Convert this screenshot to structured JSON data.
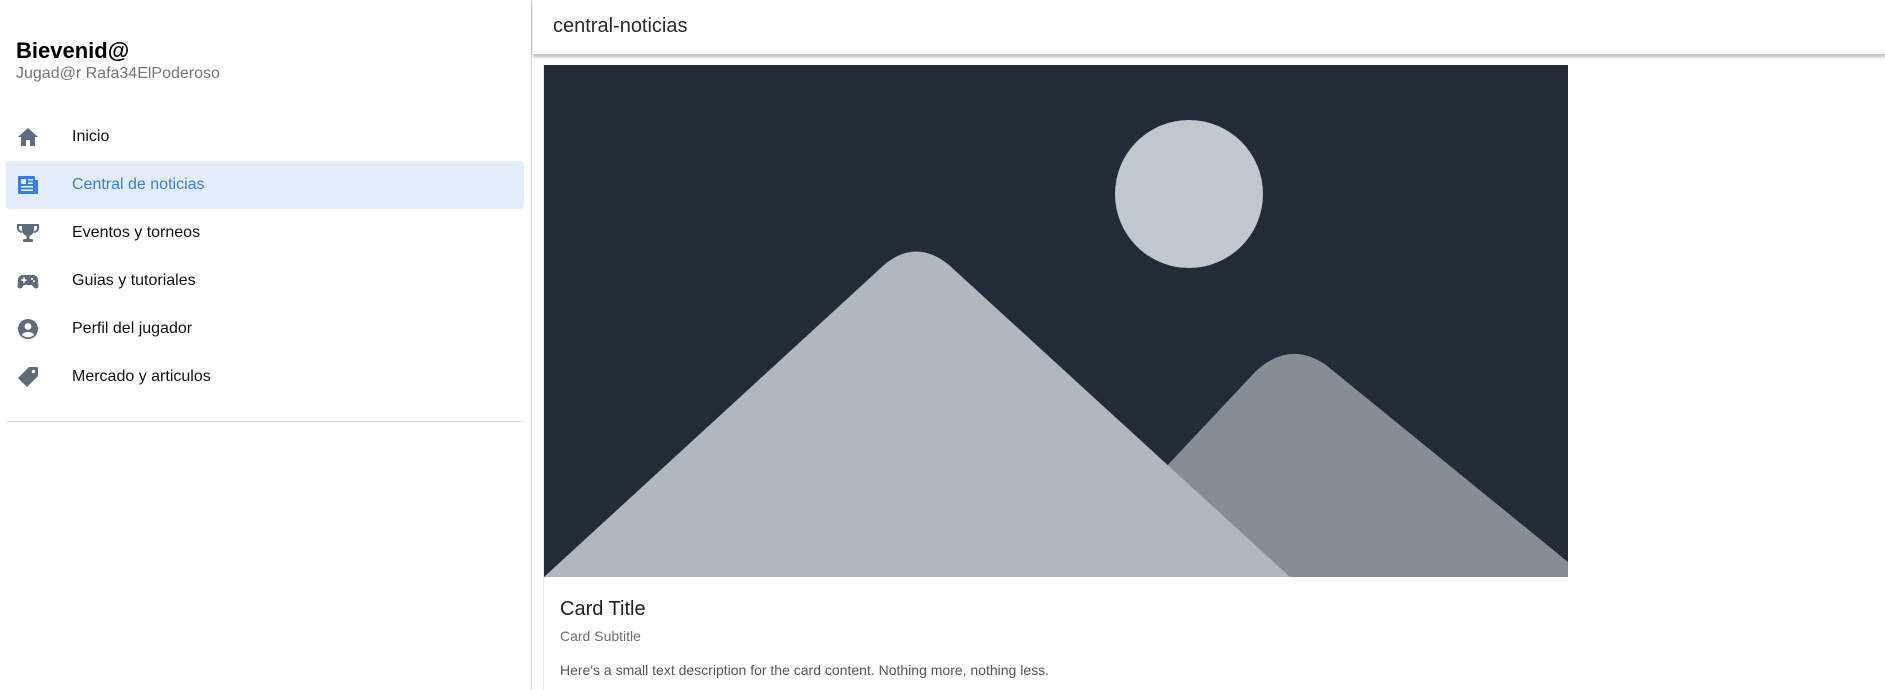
{
  "sidebar": {
    "welcome_title": "Bievenid@",
    "welcome_subtitle": "Jugad@r Rafa34ElPoderoso",
    "items": [
      {
        "label": "Inicio",
        "icon": "home-icon",
        "active": false
      },
      {
        "label": "Central de noticias",
        "icon": "newspaper-icon",
        "active": true
      },
      {
        "label": "Eventos y torneos",
        "icon": "trophy-icon",
        "active": false
      },
      {
        "label": "Guias y tutoriales",
        "icon": "gamepad-icon",
        "active": false
      },
      {
        "label": "Perfil del jugador",
        "icon": "user-circle-icon",
        "active": false
      },
      {
        "label": "Mercado y articulos",
        "icon": "tag-icon",
        "active": false
      }
    ]
  },
  "topbar": {
    "title": "central-noticias"
  },
  "card": {
    "image": "image-placeholder-icon",
    "title": "Card Title",
    "subtitle": "Card Subtitle",
    "text": "Here's a small text description for the card content. Nothing more, nothing less."
  },
  "colors": {
    "accent": "#3b7ddd",
    "active_bg": "#e3ecfb",
    "icon_gray": "#5f6b7a",
    "placeholder_bg": "#212c38",
    "placeholder_sun": "#c1c7ce",
    "placeholder_mountain_front": "#b1b7be",
    "placeholder_mountain_back": "#878d95"
  }
}
